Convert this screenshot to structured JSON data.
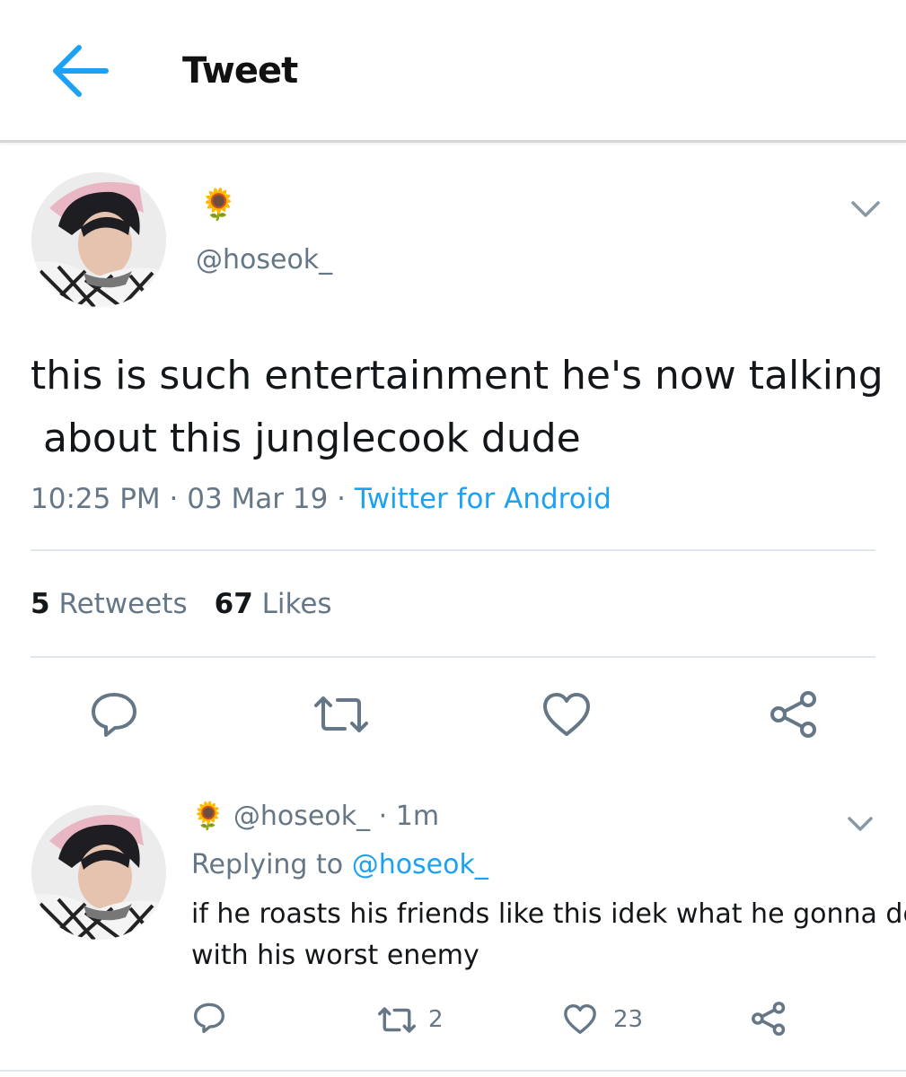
{
  "header": {
    "title": "Tweet",
    "back_icon": "back-arrow-icon",
    "accent": "#1da1f2"
  },
  "tweet": {
    "display_name_emoji": "🌻",
    "handle": "@hoseok_",
    "text_lines": [
      "this is such entertainment he's now talking",
      " about this junglecook dude"
    ],
    "time": "10:25 PM",
    "date": "03 Mar 19",
    "separator": "·",
    "source": "Twitter for Android",
    "retweets_count": "5",
    "retweets_label": "Retweets",
    "likes_count": "67",
    "likes_label": "Likes",
    "actions": [
      "reply-icon",
      "retweet-icon",
      "like-icon",
      "share-icon"
    ]
  },
  "reply": {
    "display_name_emoji": "🌻",
    "handle": "@hoseok_",
    "separator": "·",
    "time_ago": "1m",
    "replying_to_label": "Replying to",
    "replying_to_handle": "@hoseok_",
    "text_lines": [
      "if he roasts his friends like this idek what he gonna do",
      "with his worst enemy"
    ],
    "retweet_count": "2",
    "like_count": "23",
    "actions": [
      "reply-icon",
      "retweet-icon",
      "like-icon",
      "share-icon"
    ]
  },
  "colors": {
    "secondary_text": "#657786",
    "link": "#1da1f2",
    "divider": "#e1e8ed"
  }
}
